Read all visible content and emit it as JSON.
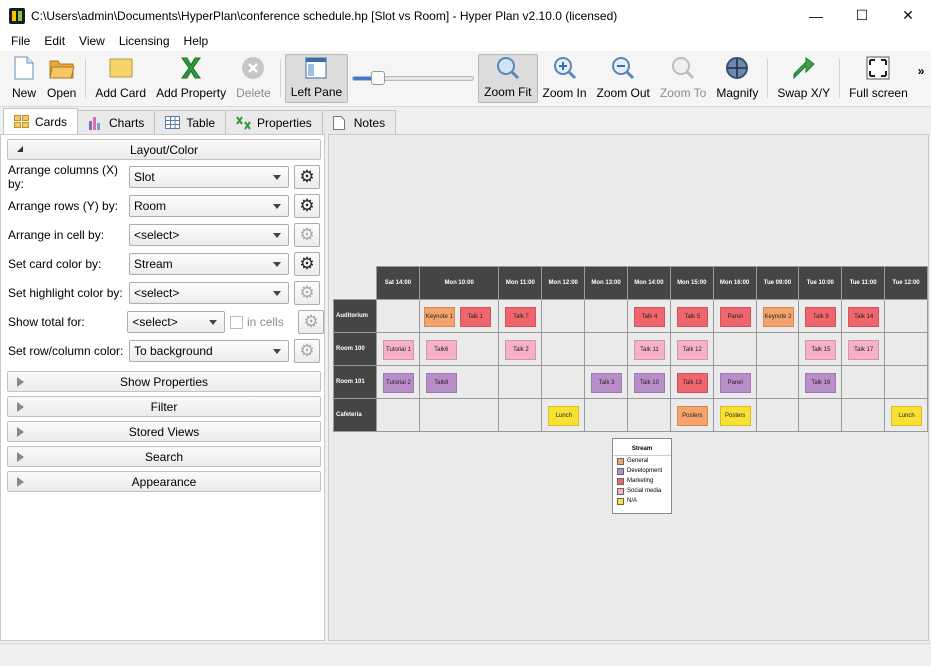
{
  "window": {
    "title": "C:\\Users\\admin\\Documents\\HyperPlan\\conference schedule.hp [Slot vs Room] - Hyper Plan v2.10.0 (licensed)",
    "minimize": "—",
    "maximize": "☐",
    "close": "✕"
  },
  "menu": [
    "File",
    "Edit",
    "View",
    "Licensing",
    "Help"
  ],
  "toolbar": {
    "new": "New",
    "open": "Open",
    "add_card": "Add Card",
    "add_property": "Add Property",
    "delete": "Delete",
    "left_pane": "Left Pane",
    "zoom_fit": "Zoom Fit",
    "zoom_in": "Zoom In",
    "zoom_out": "Zoom Out",
    "zoom_to": "Zoom To",
    "magnify": "Magnify",
    "swap_xy": "Swap X/Y",
    "full_screen": "Full screen",
    "overflow": "»",
    "zoom_slider_value": 0.18
  },
  "tabs": [
    "Cards",
    "Charts",
    "Table",
    "Properties",
    "Notes"
  ],
  "left": {
    "layout_header": "Layout/Color",
    "rows": [
      {
        "label": "Arrange columns (X) by:",
        "value": "Slot"
      },
      {
        "label": "Arrange rows (Y) by:",
        "value": "Room"
      },
      {
        "label": "Arrange in cell by:",
        "value": "<select>"
      },
      {
        "label": "Set card color by:",
        "value": "Stream"
      },
      {
        "label": "Set highlight color by:",
        "value": "<select>"
      },
      {
        "label": "Show total for:",
        "value": "<select>",
        "extra": "in cells"
      },
      {
        "label": "Set row/column color:",
        "value": "To background"
      }
    ],
    "sections": [
      "Show Properties",
      "Filter",
      "Stored Views",
      "Search",
      "Appearance"
    ]
  },
  "grid": {
    "columns": [
      "Sat 14:00",
      "Mon 10:00",
      "Mon 11:00",
      "Mon 12:00",
      "Mon 13:00",
      "Mon 14:00",
      "Mon 15:00",
      "Mon 16:00",
      "Tue 09:00",
      "Tue 10:00",
      "Tue 11:00",
      "Tue 12:00"
    ],
    "rows": [
      {
        "name": "Auditorium",
        "cells": [
          null,
          [
            {
              "t": "Keynote 1",
              "s": "General"
            },
            {
              "t": "Talk 1",
              "s": "Marketing"
            }
          ],
          [
            {
              "t": "Talk 7",
              "s": "Marketing"
            }
          ],
          null,
          null,
          [
            {
              "t": "Talk 4",
              "s": "Marketing"
            }
          ],
          [
            {
              "t": "Talk 5",
              "s": "Marketing"
            }
          ],
          [
            {
              "t": "Panel",
              "s": "Marketing"
            }
          ],
          [
            {
              "t": "Keynote 2",
              "s": "General"
            }
          ],
          [
            {
              "t": "Talk 9",
              "s": "Marketing"
            }
          ],
          [
            {
              "t": "Talk 14",
              "s": "Marketing"
            }
          ],
          null
        ]
      },
      {
        "name": "Room 100",
        "cells": [
          [
            {
              "t": "Tutorial 1",
              "s": "Social media"
            }
          ],
          [
            {
              "t": "Talk6",
              "s": "Social media"
            }
          ],
          [
            {
              "t": "Talk 2",
              "s": "Social media"
            }
          ],
          null,
          null,
          [
            {
              "t": "Talk 11",
              "s": "Social media"
            }
          ],
          [
            {
              "t": "Talk 12",
              "s": "Social media"
            }
          ],
          null,
          null,
          [
            {
              "t": "Talk 15",
              "s": "Social media"
            }
          ],
          [
            {
              "t": "Talk 17",
              "s": "Social media"
            }
          ],
          null
        ]
      },
      {
        "name": "Room 101",
        "cells": [
          [
            {
              "t": "Tutorial 2",
              "s": "Development"
            }
          ],
          [
            {
              "t": "Talk8",
              "s": "Development"
            }
          ],
          null,
          null,
          [
            {
              "t": "Talk 3",
              "s": "Development"
            }
          ],
          [
            {
              "t": "Talk 10",
              "s": "Development"
            }
          ],
          [
            {
              "t": "Talk 13",
              "s": "Marketing"
            }
          ],
          [
            {
              "t": "Panel",
              "s": "Development"
            }
          ],
          null,
          [
            {
              "t": "Talk 16",
              "s": "Development"
            }
          ],
          null,
          null
        ]
      },
      {
        "name": "Cafeteria",
        "cells": [
          null,
          null,
          null,
          [
            {
              "t": "Lunch",
              "s": "N/A"
            }
          ],
          null,
          null,
          [
            {
              "t": "Posters",
              "s": "General"
            }
          ],
          [
            {
              "t": "Posters",
              "s": "N/A"
            }
          ],
          null,
          null,
          null,
          [
            {
              "t": "Lunch",
              "s": "N/A"
            }
          ]
        ]
      }
    ]
  },
  "legend": {
    "title": "Stream",
    "items": [
      {
        "label": "General",
        "color": "#f4a46a"
      },
      {
        "label": "Development",
        "color": "#b98dc9"
      },
      {
        "label": "Marketing",
        "color": "#f0666f"
      },
      {
        "label": "Social media",
        "color": "#f6b1c6"
      },
      {
        "label": "N/A",
        "color": "#f9e132"
      }
    ]
  }
}
